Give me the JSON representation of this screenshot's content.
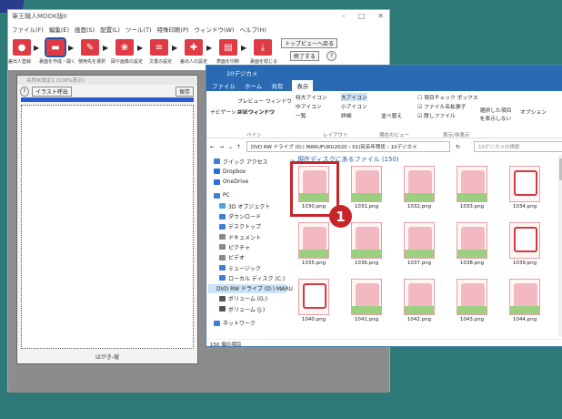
{
  "app": {
    "title": "筆王職人MOOK版II",
    "menu": [
      "ファイル(F)",
      "編集(E)",
      "画面(S)",
      "配置(L)",
      "ツール(T)",
      "特殊印刷(P)",
      "ウィンドウ(W)",
      "ヘルプ(H)"
    ],
    "toolbar": {
      "items": [
        {
          "label": "差出人登録",
          "icon": "person-icon"
        },
        {
          "label": "裏面を作成・開く",
          "icon": "folder-icon"
        },
        {
          "label": "使用先を選択",
          "icon": "pen-icon"
        },
        {
          "label": "図や画像の設定",
          "icon": "image-icon"
        },
        {
          "label": "文書の設定",
          "icon": "document-icon"
        },
        {
          "label": "差出人の設定",
          "icon": "person-add-icon"
        },
        {
          "label": "表面を印刷",
          "icon": "printer-icon"
        },
        {
          "label": "裏面を閉じる",
          "icon": "download-icon"
        }
      ],
      "home_label": "トップビューへ戻る",
      "exit_label": "終了する",
      "help_label": "?"
    }
  },
  "doc": {
    "title": "名称未設定1 (100%表示)",
    "help_icon": "?",
    "illustration_btn": "イラスト呼出",
    "save_btn": "保存",
    "footer": "はがき-縦"
  },
  "explorer": {
    "title": "10デジカメ",
    "tabs": [
      "ファイル",
      "ホーム",
      "共有",
      "表示"
    ],
    "ribbon": {
      "preview_pane": "プレビュー ウィンドウ",
      "details_pane": "詳細ウィンドウ",
      "nav_pane": "ナビゲーション ウィンドウ",
      "xl_icons": "特大アイコン",
      "large_icons": "大アイコン",
      "medium_icons": "中アイコン",
      "small_icons": "小アイコン",
      "list": "一覧",
      "details": "詳細",
      "sort": "並べ替え",
      "item_check": "項目チェック ボックス",
      "ext": "ファイル名拡張子",
      "hidden": "隠しファイル",
      "hide_selected": "選択した項目を表示しない",
      "options": "オプション",
      "group_pane": "ペイン",
      "group_layout": "レイアウト",
      "group_view": "現在のビュー",
      "group_showhide": "表示/非表示"
    },
    "address": "DVD RW ドライブ (D:) MARUFUKU2020 › 01)宛名年賀状 › 10デジカメ",
    "search_placeholder": "10デジカメの検索",
    "nav_items": [
      {
        "label": "クイック アクセス",
        "icon": "star-icon",
        "color": "#3d7fd6"
      },
      {
        "label": "Dropbox",
        "icon": "dropbox-icon",
        "color": "#2b6de0"
      },
      {
        "label": "OneDrive",
        "icon": "cloud-icon",
        "color": "#2b6de0"
      },
      {
        "label": "PC",
        "icon": "pc-icon",
        "color": "#3d7fd6"
      },
      {
        "label": "3D オブジェクト",
        "icon": "cube-icon",
        "color": "#4aa4e0"
      },
      {
        "label": "ダウンロード",
        "icon": "download-icon",
        "color": "#3d7fd6"
      },
      {
        "label": "デスクトップ",
        "icon": "desktop-icon",
        "color": "#3d7fd6"
      },
      {
        "label": "ドキュメント",
        "icon": "document-icon",
        "color": "#888888"
      },
      {
        "label": "ピクチャ",
        "icon": "picture-icon",
        "color": "#888888"
      },
      {
        "label": "ビデオ",
        "icon": "video-icon",
        "color": "#888888"
      },
      {
        "label": "ミュージック",
        "icon": "music-icon",
        "color": "#3d7fd6"
      },
      {
        "label": "ローカル ディスク (C:)",
        "icon": "disk-icon",
        "color": "#3d7fd6"
      },
      {
        "label": "DVD RW ドライブ (D:) MARU",
        "icon": "dvd-icon",
        "color": "#c8252a"
      },
      {
        "label": "ボリューム (G:)",
        "icon": "drive-icon",
        "color": "#555555"
      },
      {
        "label": "ボリューム (J:)",
        "icon": "drive-icon",
        "color": "#555555"
      },
      {
        "label": "ネットワーク",
        "icon": "network-icon",
        "color": "#3d7fd6"
      }
    ],
    "group_header": "現在ディスクにあるファイル (150)",
    "files": [
      "1030.png",
      "1031.png",
      "1032.png",
      "1033.png",
      "1034.png",
      "1035.png",
      "1036.png",
      "1037.png",
      "1038.png",
      "1039.png",
      "1040.png",
      "1041.png",
      "1042.png",
      "1043.png",
      "1044.png"
    ],
    "status": "150 個の項目"
  },
  "callout": {
    "number": "1"
  },
  "colors": {
    "background": "#2e7a78",
    "accent": "#c8252a",
    "toolbar_red": "#e03a44",
    "explorer_blue": "#2a6ab3"
  }
}
